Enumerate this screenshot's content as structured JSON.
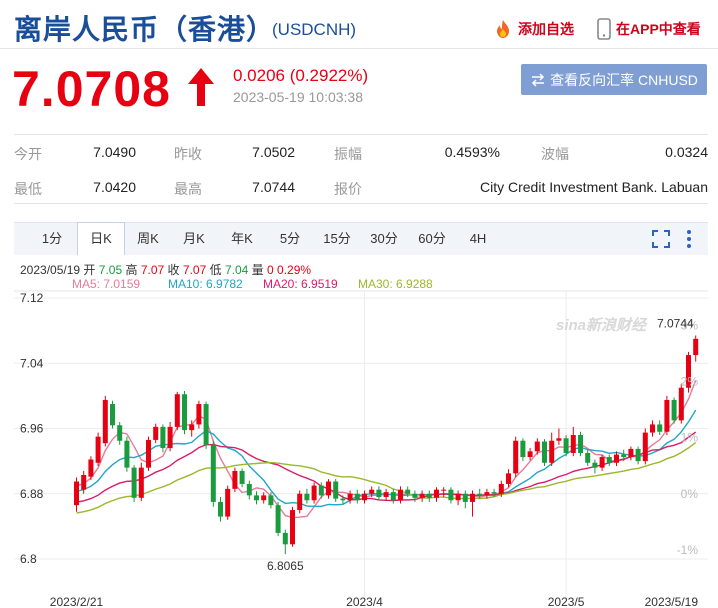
{
  "header": {
    "title": "离岸人民币（香港）",
    "code": "(USDCNH)",
    "add_watch": "添加自选",
    "view_in_app": "在APP中查看"
  },
  "quote": {
    "price": "7.0708",
    "change": "0.0206 (0.2922%)",
    "datetime": "2023-05-19 10:03:38",
    "reverse_button": "查看反向汇率 CNHUSD"
  },
  "stats": [
    {
      "label": "今开",
      "value": "7.0490"
    },
    {
      "label": "昨收",
      "value": "7.0502"
    },
    {
      "label": "振幅",
      "value": "0.4593%"
    },
    {
      "label": "波幅",
      "value": "0.0324"
    },
    {
      "label": "最低",
      "value": "7.0420"
    },
    {
      "label": "最高",
      "value": "7.0744"
    },
    {
      "label": "报价",
      "value": "City Credit Investment Bank. Labuan"
    }
  ],
  "tabs": [
    "1分",
    "日K",
    "周K",
    "月K",
    "年K",
    "5分",
    "15分",
    "30分",
    "60分",
    "4H"
  ],
  "active_tab": "日K",
  "ohlc": {
    "date": "2023/05/19",
    "open_label": "开",
    "open": "7.05",
    "high_label": "高",
    "high": "7.07",
    "close_label": "收",
    "close": "7.07",
    "low_label": "低",
    "low": "7.04",
    "volume_label": "量",
    "volume": "0",
    "change_pct": "0.29%"
  },
  "ma_legend": [
    {
      "text": "MA5: 7.0159",
      "color": "#e87a9a"
    },
    {
      "text": "MA10: 6.9782",
      "color": "#1fa6c9"
    },
    {
      "text": "MA20: 6.9519",
      "color": "#d81d6b"
    },
    {
      "text": "MA30: 6.9288",
      "color": "#9ab82b"
    }
  ],
  "colors": {
    "up": "#e60012",
    "down": "#1a9b3e",
    "brand": "#1a4e9a"
  },
  "chart_data": {
    "type": "candlestick",
    "y_ticks": [
      "7.12",
      "7.04",
      "6.96",
      "6.88",
      "6.8"
    ],
    "y_tick_values": [
      7.12,
      7.04,
      6.96,
      6.88,
      6.8
    ],
    "pct_ticks": [
      "3%",
      "2%",
      "1%",
      "0%",
      "-1%"
    ],
    "pct_tick_values": [
      3,
      2,
      1,
      0,
      -1
    ],
    "ylim": [
      6.8,
      7.12
    ],
    "x_labels": [
      "2023/2/21",
      "2023/4",
      "2023/5",
      "2023/5/19"
    ],
    "x_label_index": [
      0,
      40,
      68,
      86
    ],
    "max_label": "7.0744",
    "min_label": "6.8065",
    "watermark": "sina新浪财经",
    "candles": [
      [
        6.866,
        6.895,
        6.9,
        6.858
      ],
      [
        6.885,
        6.903,
        6.908,
        6.88
      ],
      [
        6.901,
        6.922,
        6.926,
        6.897
      ],
      [
        6.918,
        6.95,
        6.955,
        6.914
      ],
      [
        6.942,
        6.995,
        7.0,
        6.938
      ],
      [
        6.99,
        6.964,
        6.994,
        6.96
      ],
      [
        6.964,
        6.945,
        6.968,
        6.94
      ],
      [
        6.945,
        6.912,
        6.95,
        6.907
      ],
      [
        6.912,
        6.875,
        6.915,
        6.87
      ],
      [
        6.875,
        6.912,
        6.918,
        6.871
      ],
      [
        6.912,
        6.946,
        6.95,
        6.908
      ],
      [
        6.946,
        6.962,
        6.966,
        6.942
      ],
      [
        6.962,
        6.936,
        6.965,
        6.931
      ],
      [
        6.936,
        6.962,
        6.968,
        6.932
      ],
      [
        6.962,
        7.002,
        7.005,
        6.958
      ],
      [
        7.002,
        6.958,
        7.006,
        6.953
      ],
      [
        6.958,
        6.965,
        6.97,
        6.95
      ],
      [
        6.965,
        6.99,
        6.994,
        6.96
      ],
      [
        6.99,
        6.94,
        6.993,
        6.935
      ],
      [
        6.94,
        6.87,
        6.945,
        6.864
      ],
      [
        6.87,
        6.852,
        6.876,
        6.846
      ],
      [
        6.852,
        6.886,
        6.89,
        6.848
      ],
      [
        6.886,
        6.908,
        6.912,
        6.882
      ],
      [
        6.908,
        6.892,
        6.911,
        6.888
      ],
      [
        6.892,
        6.878,
        6.896,
        6.873
      ],
      [
        6.878,
        6.872,
        6.883,
        6.867
      ],
      [
        6.872,
        6.878,
        6.882,
        6.868
      ],
      [
        6.878,
        6.866,
        6.882,
        6.862
      ],
      [
        6.866,
        6.832,
        6.87,
        6.828
      ],
      [
        6.832,
        6.818,
        6.836,
        6.806
      ],
      [
        6.818,
        6.86,
        6.864,
        6.815
      ],
      [
        6.86,
        6.88,
        6.884,
        6.856
      ],
      [
        6.88,
        6.872,
        6.886,
        6.868
      ],
      [
        6.872,
        6.89,
        6.894,
        6.868
      ],
      [
        6.89,
        6.878,
        6.894,
        6.874
      ],
      [
        6.878,
        6.895,
        6.898,
        6.874
      ],
      [
        6.895,
        6.874,
        6.898,
        6.87
      ],
      [
        6.874,
        6.872,
        6.878,
        6.868
      ],
      [
        6.872,
        6.88,
        6.884,
        6.868
      ],
      [
        6.88,
        6.872,
        6.885,
        6.868
      ],
      [
        6.872,
        6.88,
        6.884,
        6.868
      ],
      [
        6.88,
        6.885,
        6.889,
        6.876
      ],
      [
        6.885,
        6.876,
        6.889,
        6.872
      ],
      [
        6.876,
        6.882,
        6.886,
        6.872
      ],
      [
        6.882,
        6.872,
        6.886,
        6.868
      ],
      [
        6.872,
        6.885,
        6.889,
        6.868
      ],
      [
        6.885,
        6.88,
        6.889,
        6.876
      ],
      [
        6.88,
        6.875,
        6.884,
        6.87
      ],
      [
        6.875,
        6.88,
        6.884,
        6.87
      ],
      [
        6.88,
        6.875,
        6.884,
        6.87
      ],
      [
        6.875,
        6.885,
        6.888,
        6.87
      ],
      [
        6.885,
        6.885,
        6.888,
        6.876
      ],
      [
        6.885,
        6.872,
        6.888,
        6.868
      ],
      [
        6.872,
        6.88,
        6.884,
        6.866
      ],
      [
        6.88,
        6.87,
        6.884,
        6.862
      ],
      [
        6.87,
        6.88,
        6.884,
        6.852
      ],
      [
        6.88,
        6.878,
        6.886,
        6.874
      ],
      [
        6.878,
        6.882,
        6.886,
        6.874
      ],
      [
        6.882,
        6.88,
        6.886,
        6.876
      ],
      [
        6.88,
        6.892,
        6.896,
        6.876
      ],
      [
        6.892,
        6.905,
        6.91,
        6.888
      ],
      [
        6.905,
        6.945,
        6.95,
        6.9
      ],
      [
        6.945,
        6.925,
        6.948,
        6.92
      ],
      [
        6.925,
        6.932,
        6.936,
        6.921
      ],
      [
        6.932,
        6.944,
        6.948,
        6.928
      ],
      [
        6.944,
        6.918,
        6.947,
        6.914
      ],
      [
        6.918,
        6.945,
        6.955,
        6.914
      ],
      [
        6.945,
        6.948,
        6.96,
        6.94
      ],
      [
        6.948,
        6.93,
        6.952,
        6.926
      ],
      [
        6.93,
        6.952,
        6.962,
        6.926
      ],
      [
        6.952,
        6.93,
        6.956,
        6.926
      ],
      [
        6.93,
        6.918,
        6.934,
        6.914
      ],
      [
        6.918,
        6.912,
        6.922,
        6.905
      ],
      [
        6.912,
        6.925,
        6.928,
        6.908
      ],
      [
        6.925,
        6.918,
        6.928,
        6.914
      ],
      [
        6.918,
        6.928,
        6.932,
        6.914
      ],
      [
        6.928,
        6.925,
        6.934,
        6.92
      ],
      [
        6.925,
        6.935,
        6.938,
        6.921
      ],
      [
        6.935,
        6.92,
        6.938,
        6.916
      ],
      [
        6.92,
        6.955,
        6.96,
        6.916
      ],
      [
        6.955,
        6.965,
        6.97,
        6.95
      ],
      [
        6.965,
        6.956,
        6.97,
        6.952
      ],
      [
        6.956,
        6.995,
        7.0,
        6.952
      ],
      [
        6.995,
        6.97,
        6.998,
        6.966
      ],
      [
        6.97,
        7.01,
        7.015,
        6.966
      ],
      [
        7.01,
        7.05,
        7.054,
        7.004
      ],
      [
        7.05,
        7.07,
        7.074,
        7.042
      ]
    ]
  }
}
